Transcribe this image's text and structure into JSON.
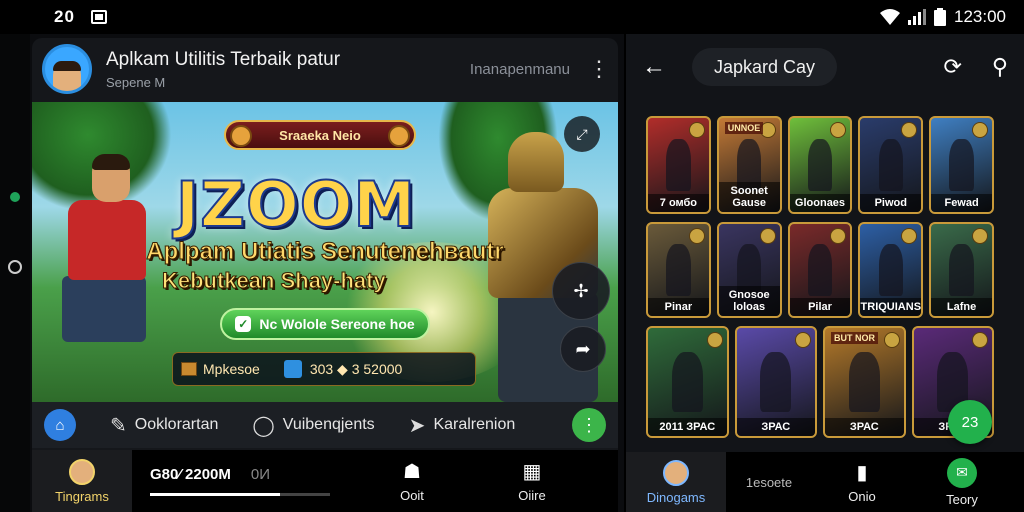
{
  "status": {
    "time": "20",
    "clock": "123:00"
  },
  "left": {
    "header": {
      "title": "Aplkam Utilitis Terbaik patur",
      "subtitle": "Sepene M",
      "right_text": "Inanapenmanu"
    },
    "banner": {
      "sale_tag": "Sraaeka Neio",
      "logo": "JZOOM",
      "tagline1": "Aplpam Utiatis Senutenehвautr",
      "tagline2": "Kebutkean Shay-haty",
      "cta": "Nc Wolole Sereone hoe",
      "stat1": "Mpkesoe",
      "stat2": "303 ◆ 3 52000"
    },
    "nav": {
      "item1": "Ooklorartan",
      "item2": "Vuibenqjents",
      "item3": "Karalrenion"
    },
    "bottom": {
      "tab1": "Tingrams",
      "media_text": "G80⁄ 2200M",
      "media_suffix": "0И",
      "progress": 0.72,
      "tab2": "Ooit",
      "tab3": "Oiire"
    }
  },
  "right": {
    "header": {
      "title": "Japkard Cay"
    },
    "grid": [
      [
        {
          "label": "7 омбо",
          "top": "",
          "color": "#b12d2a"
        },
        {
          "label": "Soonet Gause",
          "top": "UNNOЕ",
          "color": "#c47a36"
        },
        {
          "label": "Gloonaes",
          "top": "",
          "color": "#6fbf3b"
        },
        {
          "label": "Piwod",
          "top": "",
          "color": "#2a3c6b"
        },
        {
          "label": "Fewad",
          "top": "",
          "color": "#3f7fc2"
        }
      ],
      [
        {
          "label": "Pinar",
          "top": "",
          "color": "#6a5a3a"
        },
        {
          "label": "Gnosoe loloas",
          "top": "",
          "color": "#3a3560"
        },
        {
          "label": "Pilar",
          "top": "",
          "color": "#7a2a2a"
        },
        {
          "label": "TRIQUIANS",
          "top": "",
          "color": "#2d5fa5"
        },
        {
          "label": "Lafne",
          "top": "",
          "color": "#3a6b4a"
        }
      ],
      [
        {
          "label": "2011  ЗРАС",
          "top": "",
          "color": "#2f6b3a"
        },
        {
          "label": "ЗРАС",
          "top": "",
          "color": "#5a4aa8"
        },
        {
          "label": "ЗРАС",
          "top": "BUT NOR",
          "color": "#b57a2a"
        },
        {
          "label": "ЗРАС",
          "top": "",
          "color": "#5a2a78"
        }
      ]
    ],
    "fab": "23",
    "bottom": {
      "tab1": "Dinogams",
      "mid": "1esoete",
      "tab2": "Onio",
      "tab3": "Teory"
    }
  }
}
